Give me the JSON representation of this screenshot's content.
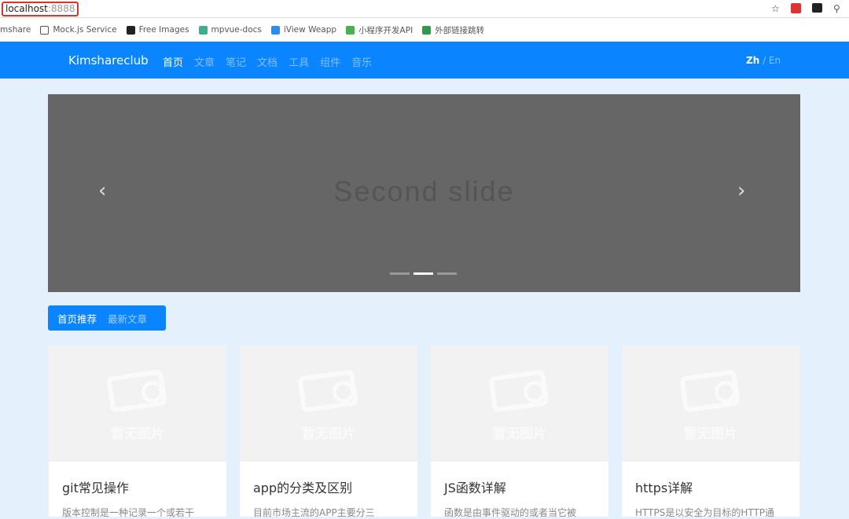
{
  "browser": {
    "url_host": "localhost",
    "url_port": ":8888",
    "bookmarks": [
      {
        "label": "mshare",
        "color": "#fff"
      },
      {
        "label": "Mock.js Service",
        "color": "#fff"
      },
      {
        "label": "Free Images",
        "color": "#222"
      },
      {
        "label": "mpvue-docs",
        "color": "#3bb08f"
      },
      {
        "label": "iView Weapp",
        "color": "#2d8cf0"
      },
      {
        "label": "小程序开发API",
        "color": "#4caf50"
      },
      {
        "label": "外部链接跳转",
        "color": "#2e9b4a"
      }
    ]
  },
  "nav": {
    "brand": "Kimshareclub",
    "items": [
      "首页",
      "文章",
      "笔记",
      "文档",
      "工具",
      "组件",
      "音乐"
    ],
    "lang_zh": "Zh",
    "lang_sep": " / ",
    "lang_en": "En"
  },
  "carousel": {
    "caption": "Second slide",
    "prev": "‹",
    "next": "›",
    "slides": 3,
    "active": 1
  },
  "tabs": [
    "首页推荐",
    "最新文章"
  ],
  "placeholder": "暂无图片",
  "cards": [
    {
      "title": "git常见操作",
      "desc": "版本控制是一种记录一个或若干"
    },
    {
      "title": "app的分类及区别",
      "desc": "目前市场主流的APP主要分三"
    },
    {
      "title": "JS函数详解",
      "desc": "函数是由事件驱动的或者当它被"
    },
    {
      "title": "https详解",
      "desc": "HTTPS是以安全为目标的HTTP通"
    }
  ]
}
